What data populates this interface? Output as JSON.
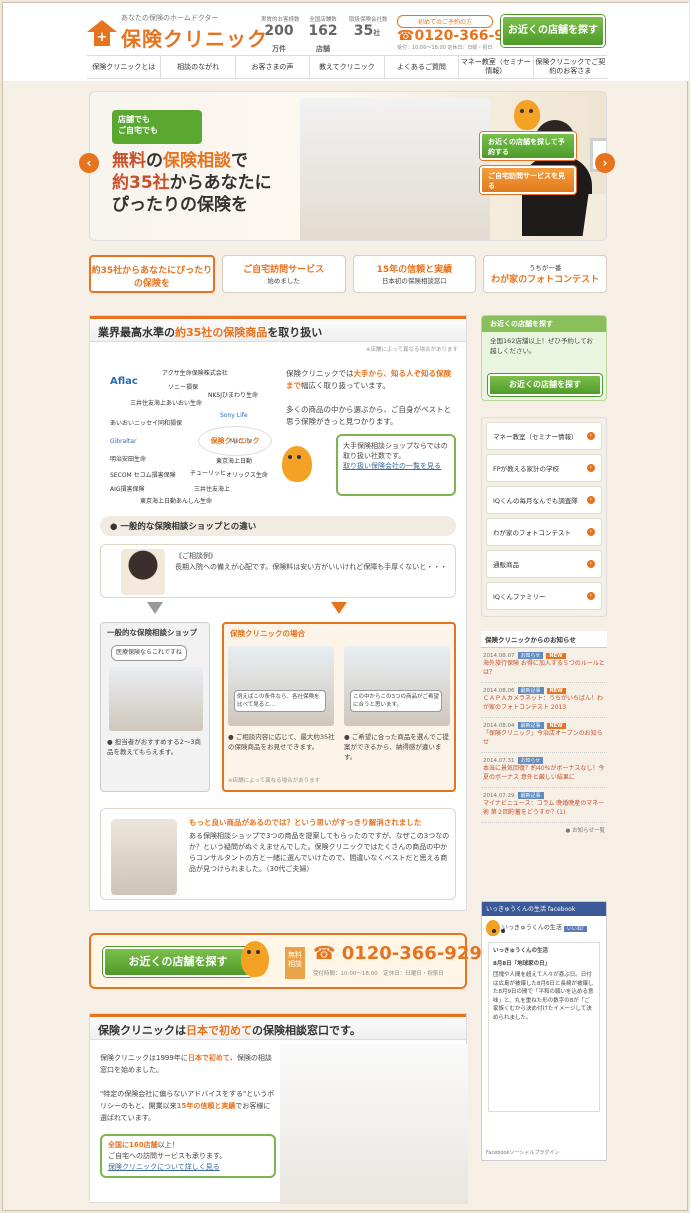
{
  "header": {
    "tagline": "あなたの保険のホームドクター",
    "brand": "保険クリニック",
    "stats": [
      {
        "label": "実質的お客様数",
        "value": "200",
        "unit": "万件"
      },
      {
        "label": "全国店舗数",
        "value": "162",
        "unit": "店舗"
      },
      {
        "label": "取扱保険会社数",
        "value": "35",
        "unit": "社"
      }
    ],
    "phone_label": "初めてのご予約の方",
    "phone": "0120-366-929",
    "phone_hours": "受付：10:00〜18:00 定休日：日曜・祝日",
    "store_button": "お近くの店舗を探す"
  },
  "nav": [
    "保険クリニックとは",
    "相談のながれ",
    "お客さまの声",
    "教えてクリニック",
    "よくあるご質問",
    "マネー教室（セミナー情報）",
    "保険クリニックでご契約のお客さま"
  ],
  "hero": {
    "badge_line1": "店舗でも",
    "badge_line2": "ご自宅でも",
    "headline_1a": "無料",
    "headline_1b": "の",
    "headline_1c": "保険相談",
    "headline_1d": "で",
    "headline_2a": "約35社",
    "headline_2b": "からあなたに",
    "headline_3": "ぴったりの保険を",
    "btn_store": "お近くの店舗を探して予約する",
    "btn_visit": "ご自宅訪問サービスを見る",
    "prev": "‹",
    "next": "›"
  },
  "tabs": [
    {
      "title": "約35社からあなたにぴったりの保険を",
      "sub": ""
    },
    {
      "title": "ご自宅訪問サービス",
      "sub": "始めました"
    },
    {
      "title": "15年の信頼と実績",
      "sub": "日本初の保険相談窓口"
    },
    {
      "title": "わが家のフォトコンテスト",
      "sub": "うちが一番"
    }
  ],
  "main": {
    "title_a": "業界最高水準の",
    "title_b": "約35社",
    "title_c": "の保険商品",
    "title_d": "を取り扱い",
    "note": "※店舗によって異なる場合があります",
    "logos": [
      "Aflac",
      "アクサ生命保険株式会社",
      "ソニー損保",
      "NKSJひまわり生命",
      "三井住友海上あいおい生命",
      "Sony Life",
      "あいおいニッセイ同和損保",
      "Gibraltar",
      "MetLife",
      "明治安田生命",
      "東京海上日動",
      "チューリッヒ",
      "オリックス生命",
      "SECOM セコム損害保険",
      "AIG損害保険",
      "三井住友海上",
      "東京海上日動あんしん生命"
    ],
    "center_logo": "保険クリニック",
    "intro_1": "保険クリニックでは",
    "intro_2": "大手から、知る人ぞ知る保険まで",
    "intro_3": "幅広く取り扱っています。",
    "intro_4": "多くの商品の中から選ぶから、ご自身がベストと思う保険がきっと見つかります。",
    "bubble_text": "大手保険相談ショップならではの取り扱い社数です。",
    "bubble_link": "取り扱い保険会社の一覧を見る",
    "compare_title": "一般的な保険相談ショップとの違い",
    "example_label": "《ご相談例》",
    "example_text": "長期入院への備えが心配です。保険料は安い方がいいけれど保障も手厚くないと・・・",
    "general_title": "一般的な保険相談ショップ",
    "general_speech": "医療保険ならこれですね",
    "general_text": "● 担当者がおすすめする2〜3商品を教えてもらえます。",
    "clinic_title": "保険クリニックの場合",
    "clinic_speech1": "例えばこの条件なら、各社保険を比べて見ると…",
    "clinic_speech2": "この中からこの3つの商品がご希望に合うと思います。",
    "clinic_text1": "● ご相談内容に応じて、最大約35社の保険商品をお見せできます。",
    "clinic_text2": "● ご希望に合った商品を選んでご提案ができるから、納得感が違います。",
    "clinic_note": "※店舗によって異なる場合があります",
    "voice_heading": "もっと良い商品があるのでは？という思いがすっきり解消されました",
    "voice_text": "ある保険相談ショップで3つの商品を提案してもらったのですが、なぜこの3つなのか？という疑問がぬぐえませんでした。保険クリニックではたくさんの商品の中からコンサルタントの方と一緒に選んでいけたので、間違いなくベストだと思える商品が見つけられました。（30代ご夫婦）"
  },
  "cta": {
    "button": "お近くの店舗を探す",
    "free": "無料相談",
    "phone": "0120-366-929",
    "hours": "受付時間：10:00〜18:00　定休日：日曜日・祝祭日"
  },
  "first": {
    "title_a": "保険クリニックは",
    "title_b": "日本で初めて",
    "title_c": "の保険相談窓口です。",
    "text_1": "保険クリニックは1999年に",
    "text_2": "日本で初めて",
    "text_3": "、保険の相談窓口を始めました。",
    "text_4": "\"特定の保険会社に偏らないアドバイスをする\"というポリシーのもと、開業以来",
    "text_5": "15年の信頼と実績",
    "text_6": "でお客様に選ばれています。",
    "green_1": "全国に160店舗",
    "green_2": "以上！",
    "green_3": "ご自宅への訪問サービスも承ります。",
    "green_link": "保険クリニックについて詳しく見る"
  },
  "sidebar": {
    "box_title": "お近くの店舗を探す",
    "box_text": "全国162店舗以上！ぜひ予約してお越しください。",
    "box_button": "お近くの店舗を探す",
    "menu": [
      "マネー教室（セミナー情報）",
      "FPが教える家計の学校",
      "IQくんの毎月なんでも調査隊",
      "わが家のフォトコンテスト",
      "通販商品",
      "IQくんファミリー"
    ],
    "news_title": "保険クリニックからのお知らせ",
    "news": [
      {
        "date": "2014.08.07",
        "cat": "お知らせ",
        "new": "NEW",
        "text": "海外旅行保険 お得に加入する５つのルールとは？"
      },
      {
        "date": "2014.08.06",
        "cat": "最新記事",
        "new": "NEW",
        "text": "ＣＡＰＡカメラネット：うちがいちばん！わが家のフォトコンテスト 2013"
      },
      {
        "date": "2014.08.04",
        "cat": "最新記事",
        "new": "NEW",
        "text": "「保険クリニック」今治店オープンのお知らせ"
      },
      {
        "date": "2014.07.31",
        "cat": "お知らせ",
        "new": "",
        "text": "本当に景気回復？約40%がボーナスなし！今夏のボーナス 意外と厳しい結果に"
      },
      {
        "date": "2014.07.29",
        "cat": "最新記事",
        "new": "",
        "text": "マイナビニュース：コラム 晩婚晩産のマネー術 第２回貯蓄をどうすか？(1)"
      }
    ],
    "news_more": "お知らせ一覧",
    "fb_header": "いっきゅうくんの生活 facebook",
    "fb_page": "いっきゅうくんの生活",
    "fb_like": "いいね!",
    "fb_post_title": "いっきゅうくんの生活",
    "fb_post_date": "8月8日「地球家の日」",
    "fb_post_text": "団塊や人間を超えて人々が喜ぶ日。日付は広島が被爆した8月6日と長崎が被爆した8月9日の間で「平和の願いを込める意味」と、丸を重ねた形の数字の8が「ご家族くむから決め付けたイメージして決められました。",
    "fb_footer": "Facebookソーシャルプラグイン"
  }
}
